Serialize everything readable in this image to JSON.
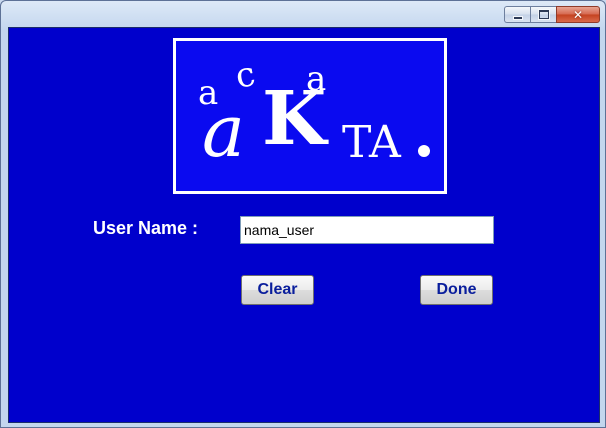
{
  "window": {
    "controls": {
      "minimize_icon": "minimize-icon",
      "maximize_icon": "maximize-icon",
      "close_icon": "close-icon",
      "close_glyph": "✕"
    }
  },
  "logo": {
    "letters": {
      "small_a": "a",
      "small_c": "c",
      "small_a2": "a",
      "big_a": "a",
      "big_k": "K",
      "ta": "TA",
      "dot": "."
    }
  },
  "form": {
    "username_label": "User Name :",
    "username_value": "nama_user",
    "clear_label": "Clear",
    "done_label": "Done"
  },
  "colors": {
    "background": "#0000cc",
    "logo_bg": "#0a0af0",
    "button_text": "#0a1e9c",
    "label_text": "#ffffff"
  }
}
